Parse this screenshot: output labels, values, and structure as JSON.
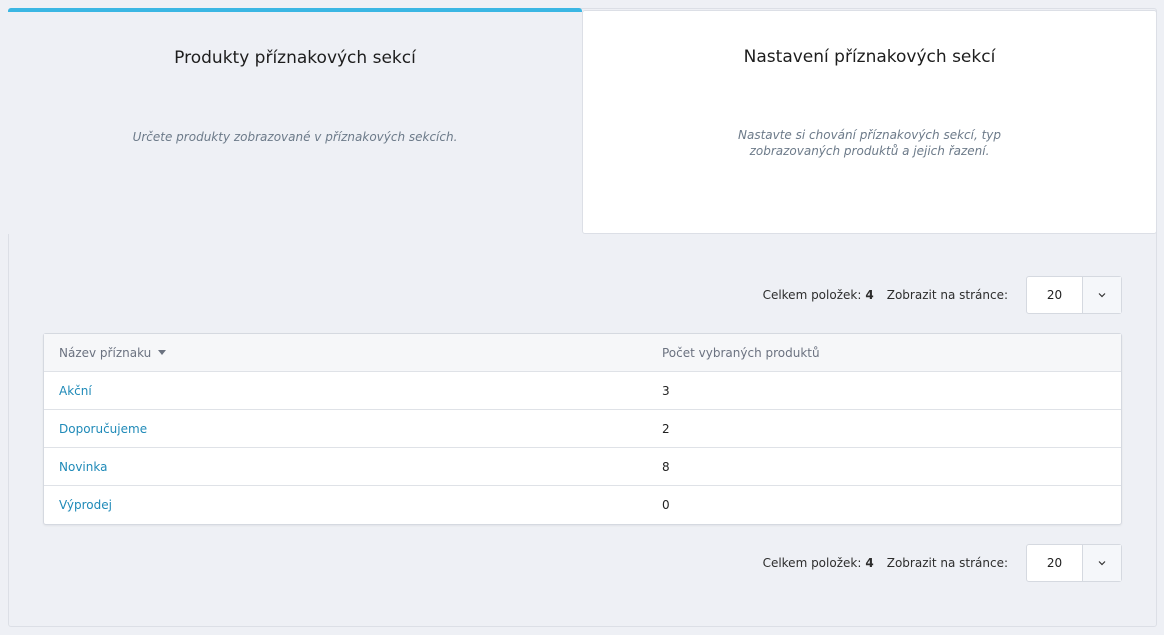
{
  "tabs": [
    {
      "title": "Produkty příznakových sekcí",
      "description": "Určete produkty zobrazované v příznakových sekcích."
    },
    {
      "title": "Nastavení příznakových sekcí",
      "description": "Nastavte si chování příznakových sekcí, typ zobrazovaných produktů a jejich řazení."
    }
  ],
  "pagination": {
    "total_label": "Celkem položek:",
    "total_value": "4",
    "per_page_label": "Zobrazit na stránce:",
    "per_page_value": "20",
    "dropdown_icon": "chevron-down-icon"
  },
  "table": {
    "columns": [
      "Název příznaku",
      "Počet vybraných produktů"
    ],
    "sort_icon": "sort-desc-icon",
    "rows": [
      {
        "name": "Akční",
        "count": "3"
      },
      {
        "name": "Doporučujeme",
        "count": "2"
      },
      {
        "name": "Novinka",
        "count": "8"
      },
      {
        "name": "Výprodej",
        "count": "0"
      }
    ]
  },
  "colors": {
    "accent": "#3ab6e3",
    "link": "#1f8ab8",
    "background": "#eef0f5"
  }
}
